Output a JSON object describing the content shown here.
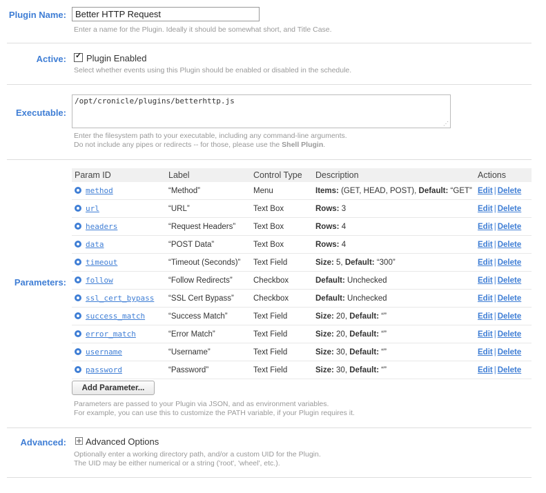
{
  "plugin_name": {
    "label": "Plugin Name:",
    "value": "Better HTTP Request",
    "caption": "Enter a name for the Plugin. Ideally it should be somewhat short, and Title Case."
  },
  "active": {
    "label": "Active:",
    "checkbox_label": "Plugin Enabled",
    "checked": true,
    "caption": "Select whether events using this Plugin should be enabled or disabled in the schedule."
  },
  "executable": {
    "label": "Executable:",
    "value": "/opt/cronicle/plugins/betterhttp.js",
    "caption_line1": "Enter the filesystem path to your executable, including any command-line arguments.",
    "caption_line2_prefix": "Do not include any pipes or redirects -- for those, please use the ",
    "caption_line2_bold": "Shell Plugin",
    "caption_line2_suffix": "."
  },
  "parameters": {
    "label": "Parameters:",
    "columns": [
      "Param ID",
      "Label",
      "Control Type",
      "Description",
      "Actions"
    ],
    "rows": [
      {
        "id": "method",
        "label": "“Method”",
        "type": "Menu",
        "desc_bold": "Items:",
        "desc_rest": " (GET, HEAD, POST), ",
        "desc_bold2": "Default:",
        "desc_rest2": " “GET”"
      },
      {
        "id": "url",
        "label": "“URL”",
        "type": "Text Box",
        "desc_bold": "Rows:",
        "desc_rest": " 3",
        "desc_bold2": "",
        "desc_rest2": ""
      },
      {
        "id": "headers",
        "label": "“Request Headers”",
        "type": "Text Box",
        "desc_bold": "Rows:",
        "desc_rest": " 4",
        "desc_bold2": "",
        "desc_rest2": ""
      },
      {
        "id": "data",
        "label": "“POST Data”",
        "type": "Text Box",
        "desc_bold": "Rows:",
        "desc_rest": " 4",
        "desc_bold2": "",
        "desc_rest2": ""
      },
      {
        "id": "timeout",
        "label": "“Timeout (Seconds)”",
        "type": "Text Field",
        "desc_bold": "Size:",
        "desc_rest": " 5, ",
        "desc_bold2": "Default:",
        "desc_rest2": " “300”"
      },
      {
        "id": "follow",
        "label": "“Follow Redirects”",
        "type": "Checkbox",
        "desc_bold": "Default:",
        "desc_rest": " Unchecked",
        "desc_bold2": "",
        "desc_rest2": ""
      },
      {
        "id": "ssl_cert_bypass",
        "label": "“SSL Cert Bypass”",
        "type": "Checkbox",
        "desc_bold": "Default:",
        "desc_rest": " Unchecked",
        "desc_bold2": "",
        "desc_rest2": ""
      },
      {
        "id": "success_match",
        "label": "“Success Match”",
        "type": "Text Field",
        "desc_bold": "Size:",
        "desc_rest": " 20, ",
        "desc_bold2": "Default:",
        "desc_rest2": " “”"
      },
      {
        "id": "error_match",
        "label": "“Error Match”",
        "type": "Text Field",
        "desc_bold": "Size:",
        "desc_rest": " 20, ",
        "desc_bold2": "Default:",
        "desc_rest2": " “”"
      },
      {
        "id": "username",
        "label": "“Username”",
        "type": "Text Field",
        "desc_bold": "Size:",
        "desc_rest": " 30, ",
        "desc_bold2": "Default:",
        "desc_rest2": " “”"
      },
      {
        "id": "password",
        "label": "“Password”",
        "type": "Text Field",
        "desc_bold": "Size:",
        "desc_rest": " 30, ",
        "desc_bold2": "Default:",
        "desc_rest2": " “”"
      }
    ],
    "edit_label": "Edit",
    "delete_label": "Delete",
    "separator": "|",
    "add_button": "Add Parameter...",
    "caption_line1": "Parameters are passed to your Plugin via JSON, and as environment variables.",
    "caption_line2": "For example, you can use this to customize the PATH variable, if your Plugin requires it."
  },
  "advanced": {
    "label": "Advanced:",
    "toggle_label": "Advanced Options",
    "caption_line1": "Optionally enter a working directory path, and/or a custom UID for the Plugin.",
    "caption_line2": "The UID may be either numerical or a string ('root', 'wheel', etc.)."
  }
}
